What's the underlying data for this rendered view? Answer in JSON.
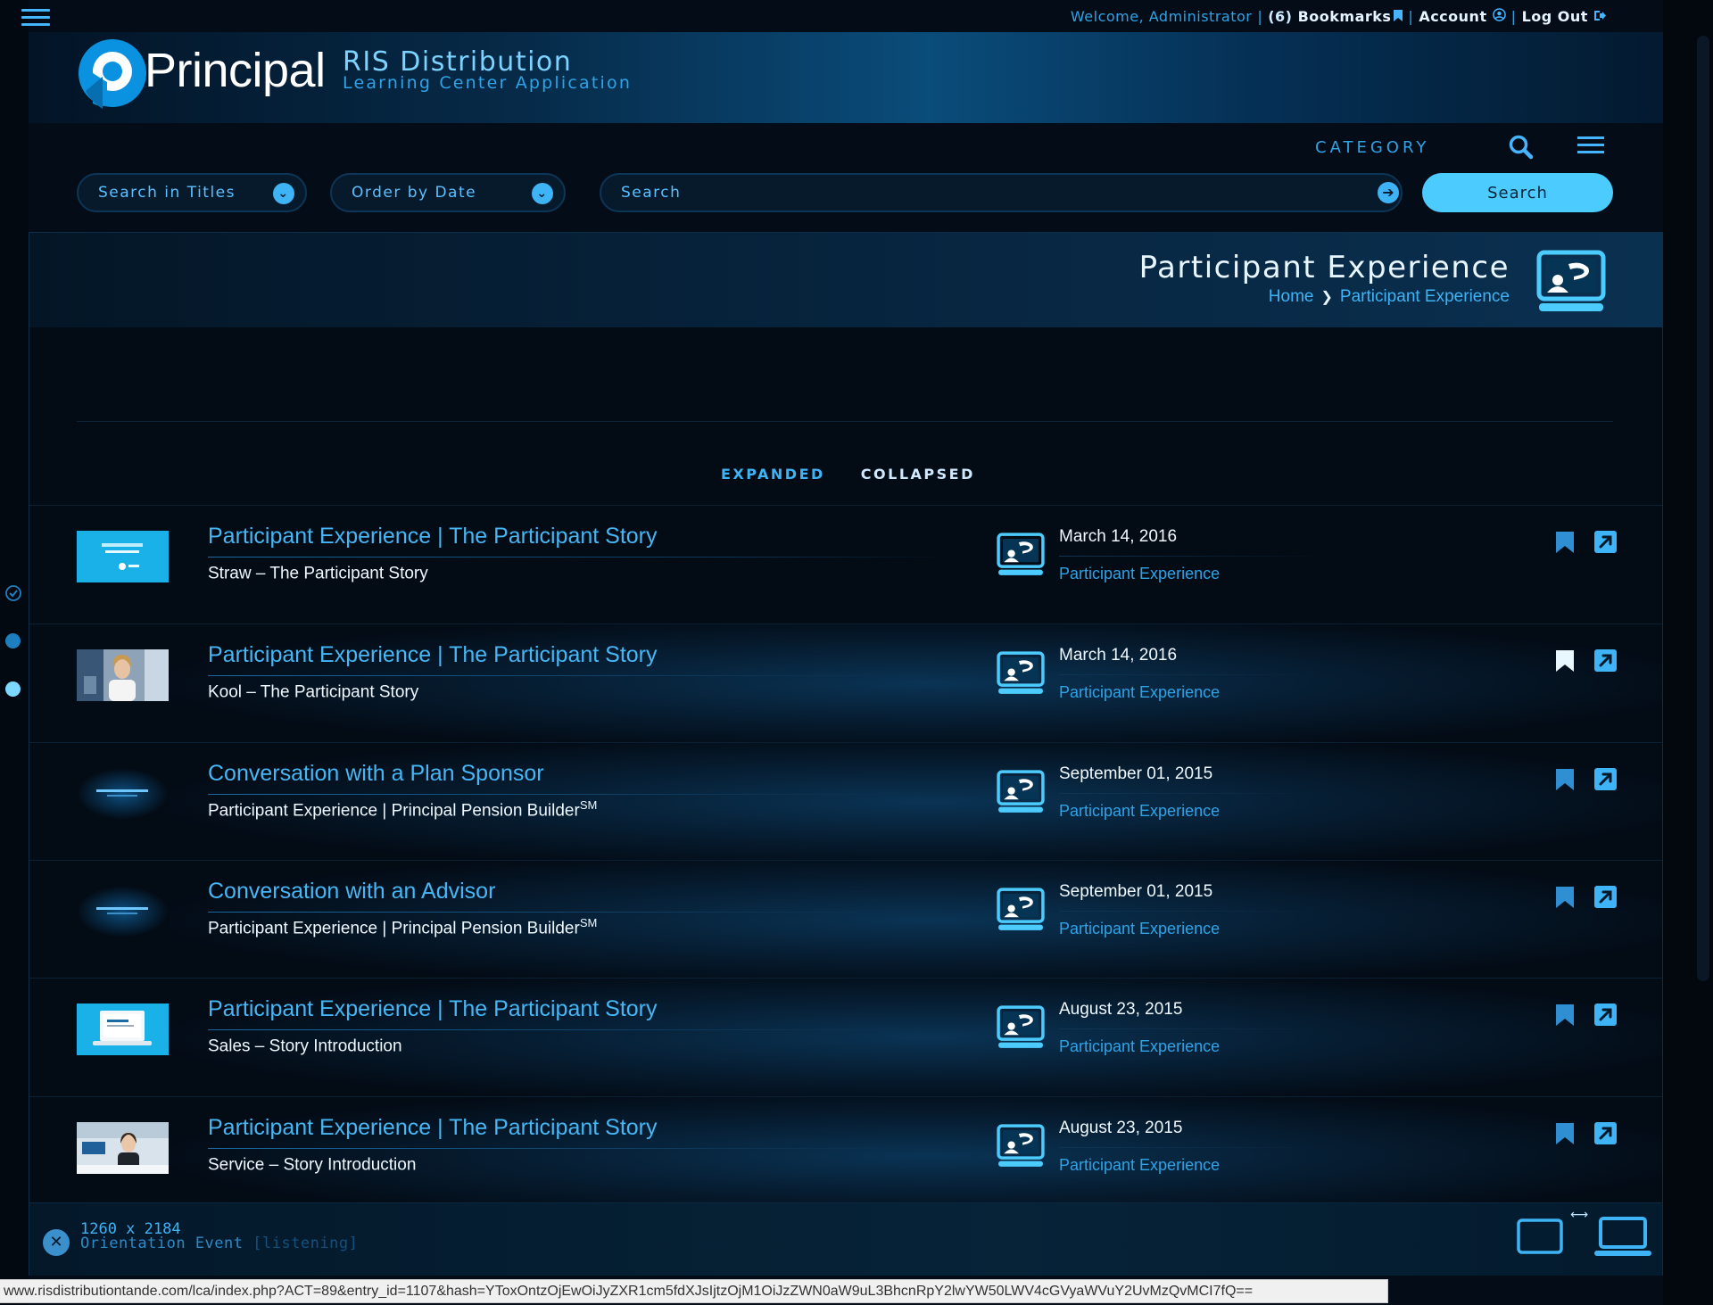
{
  "topnav": {
    "welcome": "Welcome, Administrator",
    "bookmarks_count": "(6)",
    "bookmarks_label": "Bookmarks",
    "account_label": "Account",
    "logout_label": "Log Out"
  },
  "brand": {
    "logo_text": "Principal",
    "app_title": "RIS Distribution",
    "app_subtitle": "Learning Center Application"
  },
  "category_nav": {
    "label": "CATEGORY"
  },
  "filters": {
    "search_scope": "Search in Titles",
    "order": "Order by Date",
    "search_placeholder": "Search",
    "search_button": "Search"
  },
  "page": {
    "title": "Participant Experience",
    "breadcrumb": [
      "Home",
      "Participant Experience"
    ]
  },
  "view_toggle": {
    "expanded": "EXPANDED",
    "collapsed": "COLLAPSED",
    "active": "collapsed"
  },
  "entries": [
    {
      "title": "Participant Experience | The Participant Story",
      "subtitle": "Straw – The Participant Story",
      "sup": "",
      "date": "March 14, 2016",
      "category": "Participant Experience",
      "bookmarked": false,
      "thumb": "story-slide"
    },
    {
      "title": "Participant Experience | The Participant Story",
      "subtitle": "Kool – The Participant Story",
      "sup": "",
      "date": "March 14, 2016",
      "category": "Participant Experience",
      "bookmarked": true,
      "thumb": "woman-office"
    },
    {
      "title": "Conversation with a Plan Sponsor",
      "subtitle": "Participant Experience | Principal Pension Builder",
      "sup": "SM",
      "date": "September 01, 2015",
      "category": "Participant Experience",
      "bookmarked": false,
      "thumb": "dark-slide"
    },
    {
      "title": "Conversation with an Advisor",
      "subtitle": "Participant Experience | Principal Pension Builder",
      "sup": "SM",
      "date": "September 01, 2015",
      "category": "Participant Experience",
      "bookmarked": false,
      "thumb": "dark-slide"
    },
    {
      "title": "Participant Experience | The Participant Story",
      "subtitle": "Sales – Story Introduction",
      "sup": "",
      "date": "August 23, 2015",
      "category": "Participant Experience",
      "bookmarked": false,
      "thumb": "laptop"
    },
    {
      "title": "Participant Experience | The Participant Story",
      "subtitle": "Service – Story Introduction",
      "sup": "",
      "date": "August 23, 2015",
      "category": "Participant Experience",
      "bookmarked": false,
      "thumb": "woman-slide"
    }
  ],
  "footer": {
    "dimensions": "1260 x 2184",
    "event_label": "Orientation Event",
    "event_state": "[listening]"
  },
  "status_url": "www.risdistributiontande.com/lca/index.php?ACT=89&entry_id=1107&hash=YToxOntzOjEwOiJyZXR1cm5fdXJsIjtzOjM1OiJzZWN0aW9uL3BhcnRpY2lwYW50LWV4cGVyaWVuY2UvMzQvMCI7fQ==",
  "colors": {
    "accent": "#3eb3f5",
    "background": "#040c17",
    "button": "#4ccbff"
  }
}
